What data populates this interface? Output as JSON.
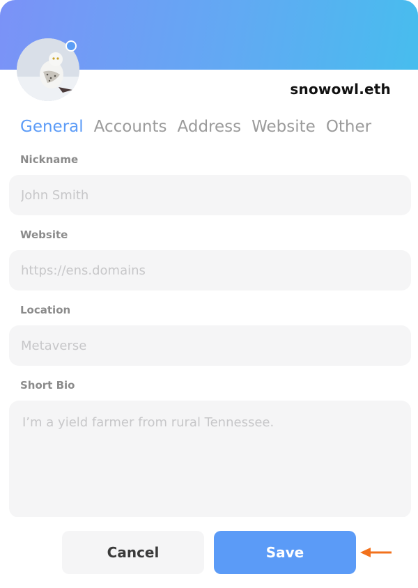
{
  "profile": {
    "ens_name": "snowowl.eth",
    "avatar_alt": "snowy owl"
  },
  "tabs": [
    {
      "label": "General",
      "active": true
    },
    {
      "label": "Accounts",
      "active": false
    },
    {
      "label": "Address",
      "active": false
    },
    {
      "label": "Website",
      "active": false
    },
    {
      "label": "Other",
      "active": false
    }
  ],
  "fields": {
    "nickname": {
      "label": "Nickname",
      "value": "",
      "placeholder": "John Smith"
    },
    "website": {
      "label": "Website",
      "value": "",
      "placeholder": "https://ens.domains"
    },
    "location": {
      "label": "Location",
      "value": "",
      "placeholder": "Metaverse"
    },
    "bio": {
      "label": "Short Bio",
      "value": "",
      "placeholder": "I’m a yield farmer from rural Tennessee."
    }
  },
  "actions": {
    "cancel_label": "Cancel",
    "save_label": "Save"
  },
  "colors": {
    "accent": "#5b9bf7",
    "pointer_arrow": "#f2711c"
  }
}
